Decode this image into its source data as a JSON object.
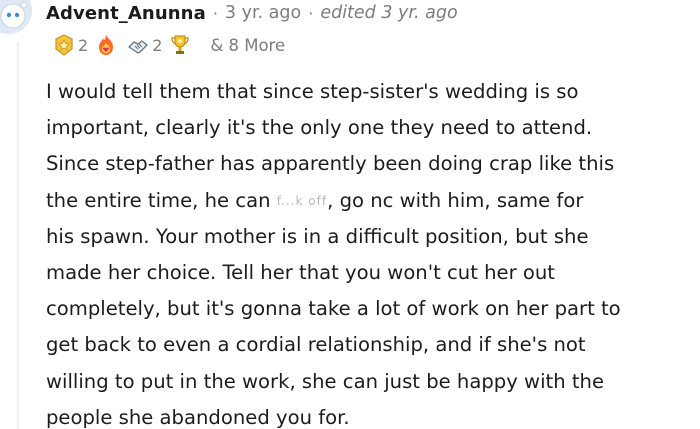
{
  "comment": {
    "author": "Advent_Anunna",
    "separator": "·",
    "time": "3 yr. ago",
    "edited": "edited 3 yr. ago",
    "awards": [
      {
        "icon": "gold-star-award-icon",
        "count": "2"
      },
      {
        "icon": "fire-heart-award-icon",
        "count": ""
      },
      {
        "icon": "handshake-award-icon",
        "count": "2"
      },
      {
        "icon": "trophy-award-icon",
        "count": ""
      }
    ],
    "more_awards": "& 8 More",
    "body_lines": [
      "I would tell them that since step-sister's wedding is so",
      "important, clearly it's the only one they need to attend.",
      "Since step-father has apparently been doing crap like this",
      "the entire time, he can ",
      "his spawn. Your mother is in a difficult position, but she",
      "made her choice. Tell her that you won't cut her out",
      "completely, but it's gonna take a lot of work on her part to",
      "get back to even a cordial relationship, and if she's not",
      "willing to put in the work, she can just be happy with the",
      "people she abandoned you for."
    ],
    "censored_text": "f...k off",
    "line4_rest": ", go nc with him, same for"
  },
  "colors": {
    "text": "#1c1c1c",
    "meta": "#7c7c7c",
    "thread_line": "#edeff1"
  }
}
